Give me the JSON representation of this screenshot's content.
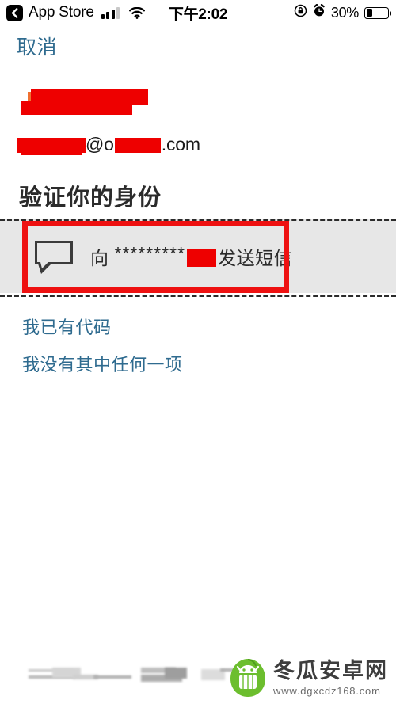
{
  "status_bar": {
    "back_label": "App Store",
    "back_icon": "chevron-left-icon",
    "signal_icon": "cellular-signal-icon",
    "wifi_icon": "wifi-icon",
    "time": "下午2:02",
    "rotation_lock_icon": "rotation-lock-icon",
    "alarm_icon": "alarm-clock-icon",
    "battery_percent": "30%",
    "battery_icon": "battery-icon",
    "battery_level": 30
  },
  "nav": {
    "cancel_label": "取消"
  },
  "account": {
    "logo_redacted": true,
    "email_at": "@o",
    "email_suffix": ".com",
    "email_user_redacted": true,
    "email_domain_redacted": true
  },
  "main": {
    "heading": "验证你的身份",
    "options": [
      {
        "icon": "message-bubble-icon",
        "prefix": "向",
        "masked_number": "*********",
        "number_redacted": true,
        "suffix": "发送短信",
        "highlighted": true
      }
    ],
    "links": [
      {
        "label": "我已有代码"
      },
      {
        "label": "我没有其中任何一项"
      }
    ]
  },
  "annotation": {
    "box_color": "#EE1111",
    "dash_color": "#2B2B2B",
    "band_color": "#E7E7E7",
    "redaction_color": "#EE0000"
  },
  "watermark": {
    "site_name": "冬瓜安卓网",
    "url": "www.dgxcdz168.com",
    "logo_icon": "winter-melon-android-logo-icon",
    "logo_color": "#6CBE2E"
  },
  "theme": {
    "link_color": "#2F6B8F",
    "text_color": "#2B2B2B",
    "background": "#FFFFFF"
  }
}
